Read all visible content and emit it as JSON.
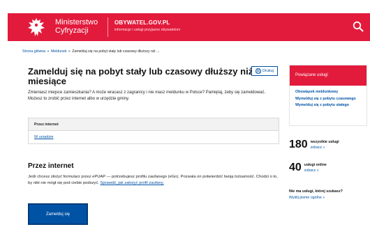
{
  "header": {
    "ministry_line1": "Ministerstwo",
    "ministry_line2": "Cyfryzacji",
    "portal_name": "OBYWATEL.GOV.PL",
    "portal_tagline": "informacje i usługi przyjazne obywatelom"
  },
  "breadcrumb": {
    "home": "Strona główna",
    "sep": "»",
    "section": "Meldunek",
    "current": "Zamelduj się na pobyt stały lub czasowy dłuższy niż ..."
  },
  "main": {
    "title": "Zamelduj się na pobyt stały lub czasowy dłuższy niż 3 miesiące",
    "print_label": "Drukuj",
    "intro": "Zmieniasz miejsce zamieszkania? A może wracasz z zagranicy i nie masz meldunku w Polsce? Pamiętaj, żeby się zameldować. Możesz to zrobić przez internet albo w urzędzie gminy.",
    "toc": {
      "header": "Przez internet",
      "link": "W urzędzie"
    },
    "section": {
      "title": "Przez internet",
      "text": "Jeśli chcesz złożyć formularz przez ePUAP — potrzebujesz profilu zaufanego (eGo). Pozwala on potwierdzić twoją tożsamość. Chodzi o to, by nikt nie mógł się pod ciebie podszyć.",
      "link": "Sprawdź, jak założyć profil zaufany."
    },
    "cta_label": "Zamelduj się"
  },
  "sidebar": {
    "related_title": "Powiązane usługi",
    "related": [
      "Obowiązek meldunkowy",
      "Wymelduj się z pobytu czasowego",
      "Wymelduj się z pobytu stałego"
    ],
    "stats": [
      {
        "number": "180",
        "label": "wszystkie usługi",
        "link": "zobacz »"
      },
      {
        "number": "40",
        "label": "usługi online",
        "link": "zobacz »"
      }
    ],
    "help_question": "Nie ma usługi, której szukasz?",
    "help_link": "Wyślij pismo ogólne »"
  },
  "colors": {
    "brand_red": "#e21b3c",
    "link_blue": "#0052a5",
    "button_blue": "#0052a5"
  },
  "icons": [
    "eagle-emblem-icon",
    "search-icon",
    "printer-icon"
  ]
}
